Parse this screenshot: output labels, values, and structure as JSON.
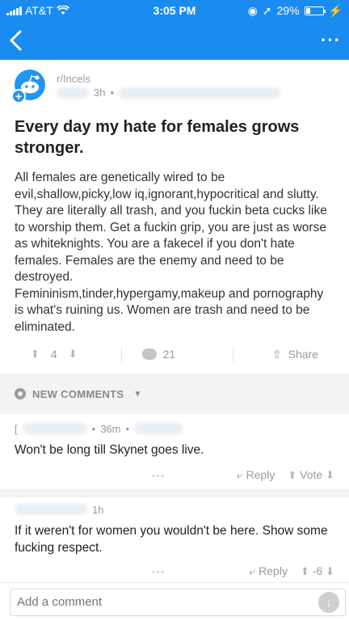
{
  "status_bar": {
    "carrier": "AT&T",
    "time": "3:05 PM",
    "battery": "29%",
    "battery_level": 0.29
  },
  "nav": {
    "back_icon": "chevron-left-icon",
    "more_icon": "more-icon"
  },
  "post": {
    "subreddit": "r/Incels",
    "age": "3h",
    "title": "Every day my hate for females grows stronger.",
    "body": "All females are genetically wired to be evil,shallow,picky,low iq,ignorant,hypocritical and slutty. They are literally all trash, and you fuckin beta cucks like to worship them. Get a fuckin grip, you are just as worse as whiteknights. You are a fakecel if you don't hate females. Females are the enemy and need to be destroyed.\nFemininism,tinder,hypergamy,makeup and pornography is what's ruining us. Women are trash and need to be eliminated.",
    "score": "4",
    "comments_count": "21",
    "share_label": "Share"
  },
  "comments_header": {
    "label": "NEW COMMENTS"
  },
  "comments": [
    {
      "author_initial": "[",
      "age": "36m",
      "text": "Won't be long till Skynet goes live.",
      "reply_label": "Reply",
      "vote_label": "Vote"
    },
    {
      "age": "1h",
      "text": "If it weren't for women you wouldn't be here. Show some fucking respect.",
      "reply_label": "Reply",
      "vote_label": "-6"
    }
  ],
  "composer": {
    "placeholder": "Add a comment"
  }
}
